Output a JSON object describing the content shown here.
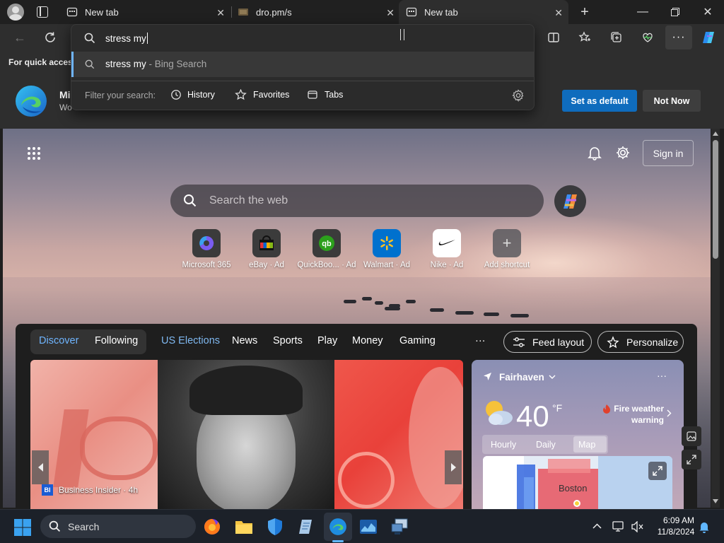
{
  "tabs": [
    {
      "title": "New tab",
      "active": false
    },
    {
      "title": "dro.pm/s",
      "active": false
    },
    {
      "title": "New tab",
      "active": true
    }
  ],
  "toolbar": {
    "sidebar_label": "For quick access"
  },
  "omnibox": {
    "query": "stress my",
    "suggestion_query": "stress my",
    "suggestion_suffix": " - Bing Search",
    "filter_label": "Filter your search:",
    "filters": [
      "History",
      "Favorites",
      "Tabs"
    ]
  },
  "banner": {
    "title_partial": "Mi",
    "subtitle_partial": "Wo",
    "set_default_label": "Set as default",
    "not_now_label": "Not Now"
  },
  "ntp": {
    "sign_in_label": "Sign in",
    "search_placeholder": "Search the web",
    "shortcuts": [
      {
        "label": "Microsoft 365",
        "icon": "microsoft-365-icon"
      },
      {
        "label": "eBay · Ad",
        "icon": "ebay-icon"
      },
      {
        "label": "QuickBoo... · Ad",
        "icon": "quickbooks-icon"
      },
      {
        "label": "Walmart · Ad",
        "icon": "walmart-icon"
      },
      {
        "label": "Nike · Ad",
        "icon": "nike-icon"
      },
      {
        "label": "Add shortcut",
        "icon": "plus-icon"
      }
    ]
  },
  "feed": {
    "nav": [
      "Discover",
      "Following",
      "US Elections",
      "News",
      "Sports",
      "Play",
      "Money",
      "Gaming"
    ],
    "more": "···",
    "feed_layout_label": "Feed layout",
    "personalize_label": "Personalize",
    "article": {
      "source": "Business Insider",
      "age": "4h",
      "source_badge": "BI"
    }
  },
  "weather": {
    "location": "Fairhaven",
    "temp": "40",
    "unit": "°F",
    "alert": "Fire weather warning",
    "tabs": [
      "Hourly",
      "Daily",
      "Map"
    ],
    "map_city": "Boston"
  },
  "taskbar": {
    "search_label": "Search",
    "time": "6:09 AM",
    "date": "11/8/2024"
  },
  "colors": {
    "accent": "#0f6cbd",
    "ntp_top": "#6e7086",
    "feed_bg": "#1e1e1e",
    "taskbar": "#1c2129"
  }
}
